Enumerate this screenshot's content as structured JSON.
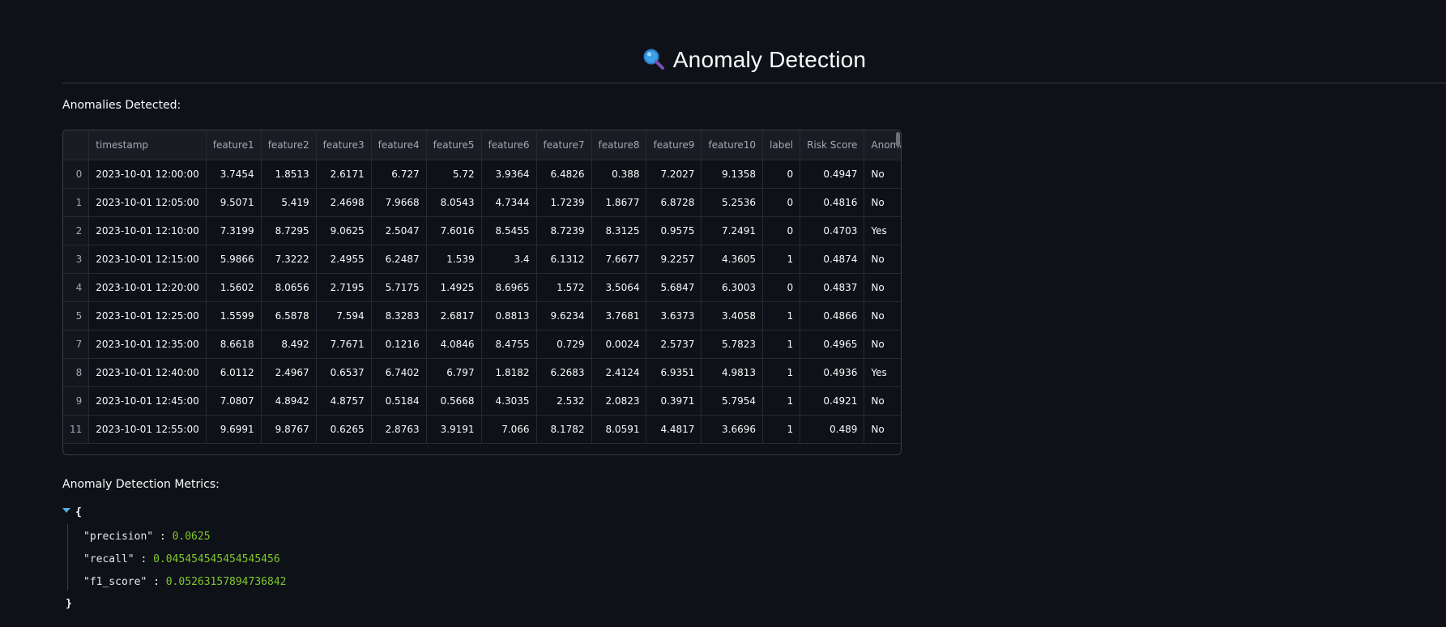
{
  "header": {
    "title": "Anomaly Detection",
    "icon": "magnifying-glass-icon"
  },
  "anomalies": {
    "caption": "Anomalies Detected:",
    "columns": [
      "",
      "timestamp",
      "feature1",
      "feature2",
      "feature3",
      "feature4",
      "feature5",
      "feature6",
      "feature7",
      "feature8",
      "feature9",
      "feature10",
      "label",
      "Risk Score",
      "Anomaly"
    ],
    "rows": [
      [
        "0",
        "2023-10-01 12:00:00",
        "3.7454",
        "1.8513",
        "2.6171",
        "6.727",
        "5.72",
        "3.9364",
        "6.4826",
        "0.388",
        "7.2027",
        "9.1358",
        "0",
        "0.4947",
        "No"
      ],
      [
        "1",
        "2023-10-01 12:05:00",
        "9.5071",
        "5.419",
        "2.4698",
        "7.9668",
        "8.0543",
        "4.7344",
        "1.7239",
        "1.8677",
        "6.8728",
        "5.2536",
        "0",
        "0.4816",
        "No"
      ],
      [
        "2",
        "2023-10-01 12:10:00",
        "7.3199",
        "8.7295",
        "9.0625",
        "2.5047",
        "7.6016",
        "8.5455",
        "8.7239",
        "8.3125",
        "0.9575",
        "7.2491",
        "0",
        "0.4703",
        "Yes"
      ],
      [
        "3",
        "2023-10-01 12:15:00",
        "5.9866",
        "7.3222",
        "2.4955",
        "6.2487",
        "1.539",
        "3.4",
        "6.1312",
        "7.6677",
        "9.2257",
        "4.3605",
        "1",
        "0.4874",
        "No"
      ],
      [
        "4",
        "2023-10-01 12:20:00",
        "1.5602",
        "8.0656",
        "2.7195",
        "5.7175",
        "1.4925",
        "8.6965",
        "1.572",
        "3.5064",
        "5.6847",
        "6.3003",
        "0",
        "0.4837",
        "No"
      ],
      [
        "5",
        "2023-10-01 12:25:00",
        "1.5599",
        "6.5878",
        "7.594",
        "8.3283",
        "2.6817",
        "0.8813",
        "9.6234",
        "3.7681",
        "3.6373",
        "3.4058",
        "1",
        "0.4866",
        "No"
      ],
      [
        "7",
        "2023-10-01 12:35:00",
        "8.6618",
        "8.492",
        "7.7671",
        "0.1216",
        "4.0846",
        "8.4755",
        "0.729",
        "0.0024",
        "2.5737",
        "5.7823",
        "1",
        "0.4965",
        "No"
      ],
      [
        "8",
        "2023-10-01 12:40:00",
        "6.0112",
        "2.4967",
        "0.6537",
        "6.7402",
        "6.797",
        "1.8182",
        "6.2683",
        "2.4124",
        "6.9351",
        "4.9813",
        "1",
        "0.4936",
        "Yes"
      ],
      [
        "9",
        "2023-10-01 12:45:00",
        "7.0807",
        "4.8942",
        "4.8757",
        "0.5184",
        "0.5668",
        "4.3035",
        "2.532",
        "2.0823",
        "0.3971",
        "5.7954",
        "1",
        "0.4921",
        "No"
      ],
      [
        "11",
        "2023-10-01 12:55:00",
        "9.6991",
        "9.8767",
        "0.6265",
        "2.8763",
        "3.9191",
        "7.066",
        "8.1782",
        "8.0591",
        "4.4817",
        "3.6696",
        "1",
        "0.489",
        "No"
      ]
    ]
  },
  "metrics": {
    "caption": "Anomaly Detection Metrics:",
    "open_brace": "{",
    "close_brace": "}",
    "entries": [
      {
        "key": "\"precision\"",
        "value": "0.0625"
      },
      {
        "key": "\"recall\"",
        "value": "0.045454545454545456"
      },
      {
        "key": "\"f1_score\"",
        "value": "0.05263157894736842"
      }
    ]
  }
}
